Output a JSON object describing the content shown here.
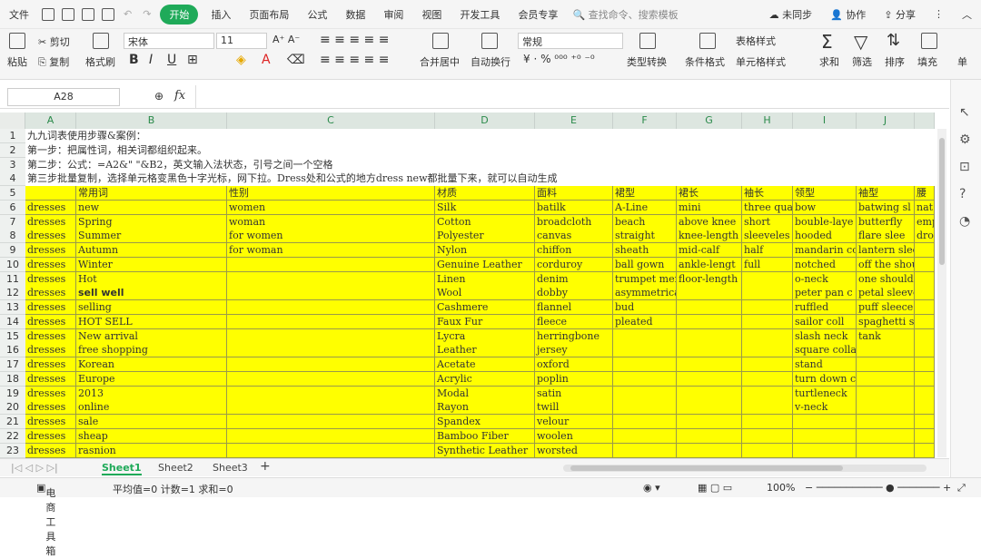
{
  "menu": {
    "file": "文件",
    "items": [
      "开始",
      "插入",
      "页面布局",
      "公式",
      "数据",
      "审阅",
      "视图",
      "开发工具",
      "会员专享"
    ],
    "search": "查找命令、搜索模板",
    "sync": "未同步",
    "collab": "协作",
    "share": "分享"
  },
  "ribbon": {
    "paste": "粘贴",
    "cut": "剪切",
    "copy": "复制",
    "format_painter": "格式刷",
    "font": "宋体",
    "size": "11",
    "merge": "合并居中",
    "wrap": "自动换行",
    "numfmt": "常规",
    "convert": "类型转换",
    "cond": "条件格式",
    "table_style": "表格样式",
    "cell_style": "单元格样式",
    "sum": "求和",
    "filter": "筛选",
    "sort": "排序",
    "fill": "填充",
    "more": "单"
  },
  "formula": {
    "cell": "A28",
    "fx": "fx"
  },
  "columns": [
    "A",
    "B",
    "C",
    "D",
    "E",
    "F",
    "G",
    "H",
    "I",
    "J"
  ],
  "rows": {
    "r1": "九九词表使用步骤&案例：",
    "r2": "第一步：把属性词，相关词都组织起来。",
    "r3": "第二步：公式：=A2&\" \"&B2，英文输入法状态，引号之间一个空格",
    "r4": "第三步批量复制，选择单元格变黑色十字光标，网下拉。Dress处和公式的地方dress new都批量下来，就可以自动生成"
  },
  "header": [
    "",
    "常用词",
    "性别",
    "材质",
    "面料",
    "裙型",
    "裙长",
    "袖长",
    "领型",
    "袖型",
    "腰"
  ],
  "table": [
    [
      "dresses",
      "new",
      "women",
      "Silk",
      "batilk",
      "A-Line",
      "mini",
      "three qua",
      "bow",
      "batwing sl",
      "nat"
    ],
    [
      "dresses",
      "Spring",
      "woman",
      "Cotton",
      "broadcloth",
      "beach",
      "above knee",
      "short",
      "bouble-laye",
      "butterfly",
      "emp"
    ],
    [
      "dresses",
      "Summer",
      "for women",
      "Polyester",
      "canvas",
      "straight",
      "knee-length",
      "sleeveles",
      "hooded",
      "flare slee",
      "dro"
    ],
    [
      "dresses",
      "Autumn",
      "for woman",
      "Nylon",
      "chiffon",
      "sheath",
      "mid-calf",
      "half",
      "mandarin co",
      "lantern slee",
      ""
    ],
    [
      "dresses",
      "Winter",
      "",
      "Genuine Leather",
      "corduroy",
      "ball gown",
      "ankle-lengt",
      "full",
      "notched",
      "off the shoul",
      ""
    ],
    [
      "dresses",
      "Hot",
      "",
      "Linen",
      "denim",
      "trumpet mer",
      "floor-length",
      "",
      "o-neck",
      "one shoulder",
      ""
    ],
    [
      "dresses",
      "sell well",
      "",
      "Wool",
      "dobby",
      "asymmetrical",
      "",
      "",
      "peter pan c",
      "petal sleeve",
      ""
    ],
    [
      "dresses",
      "selling",
      "",
      "Cashmere",
      "flannel",
      "bud",
      "",
      "",
      "ruffled",
      "puff sleece",
      ""
    ],
    [
      "dresses",
      "HOT SELL",
      "",
      "Faux Fur",
      "fleece",
      "pleated",
      "",
      "",
      "sailor coll",
      "spaghetti str",
      ""
    ],
    [
      "dresses",
      "New arrival",
      "",
      "Lycra",
      "herringbone",
      "",
      "",
      "",
      "slash neck",
      "tank",
      ""
    ],
    [
      "dresses",
      "free shopping",
      "",
      "Leather",
      "jersey",
      "",
      "",
      "",
      "square collar",
      "",
      ""
    ],
    [
      "dresses",
      "Korean",
      "",
      "Acetate",
      "oxford",
      "",
      "",
      "",
      "stand",
      "",
      ""
    ],
    [
      "dresses",
      "Europe",
      "",
      "Acrylic",
      "poplin",
      "",
      "",
      "",
      "turn down collar",
      "",
      ""
    ],
    [
      "dresses",
      "2013",
      "",
      "Modal",
      "satin",
      "",
      "",
      "",
      "turtleneck",
      "",
      ""
    ],
    [
      "dresses",
      "online",
      "",
      "Rayon",
      "twill",
      "",
      "",
      "",
      "v-neck",
      "",
      ""
    ],
    [
      "dresses",
      "sale",
      "",
      "Spandex",
      "velour",
      "",
      "",
      "",
      "",
      "",
      ""
    ],
    [
      "dresses",
      "sheap",
      "",
      "Bamboo Fiber",
      "woolen",
      "",
      "",
      "",
      "",
      "",
      ""
    ],
    [
      "dresses",
      "rasnion",
      "",
      "Synthetic Leather",
      "worsted",
      "",
      "",
      "",
      "",
      "",
      ""
    ]
  ],
  "sheets": [
    "Sheet1",
    "Sheet2",
    "Sheet3"
  ],
  "status": {
    "tool": "电商工具箱",
    "stats": "平均值=0  计数=1  求和=0",
    "zoom": "100%"
  }
}
